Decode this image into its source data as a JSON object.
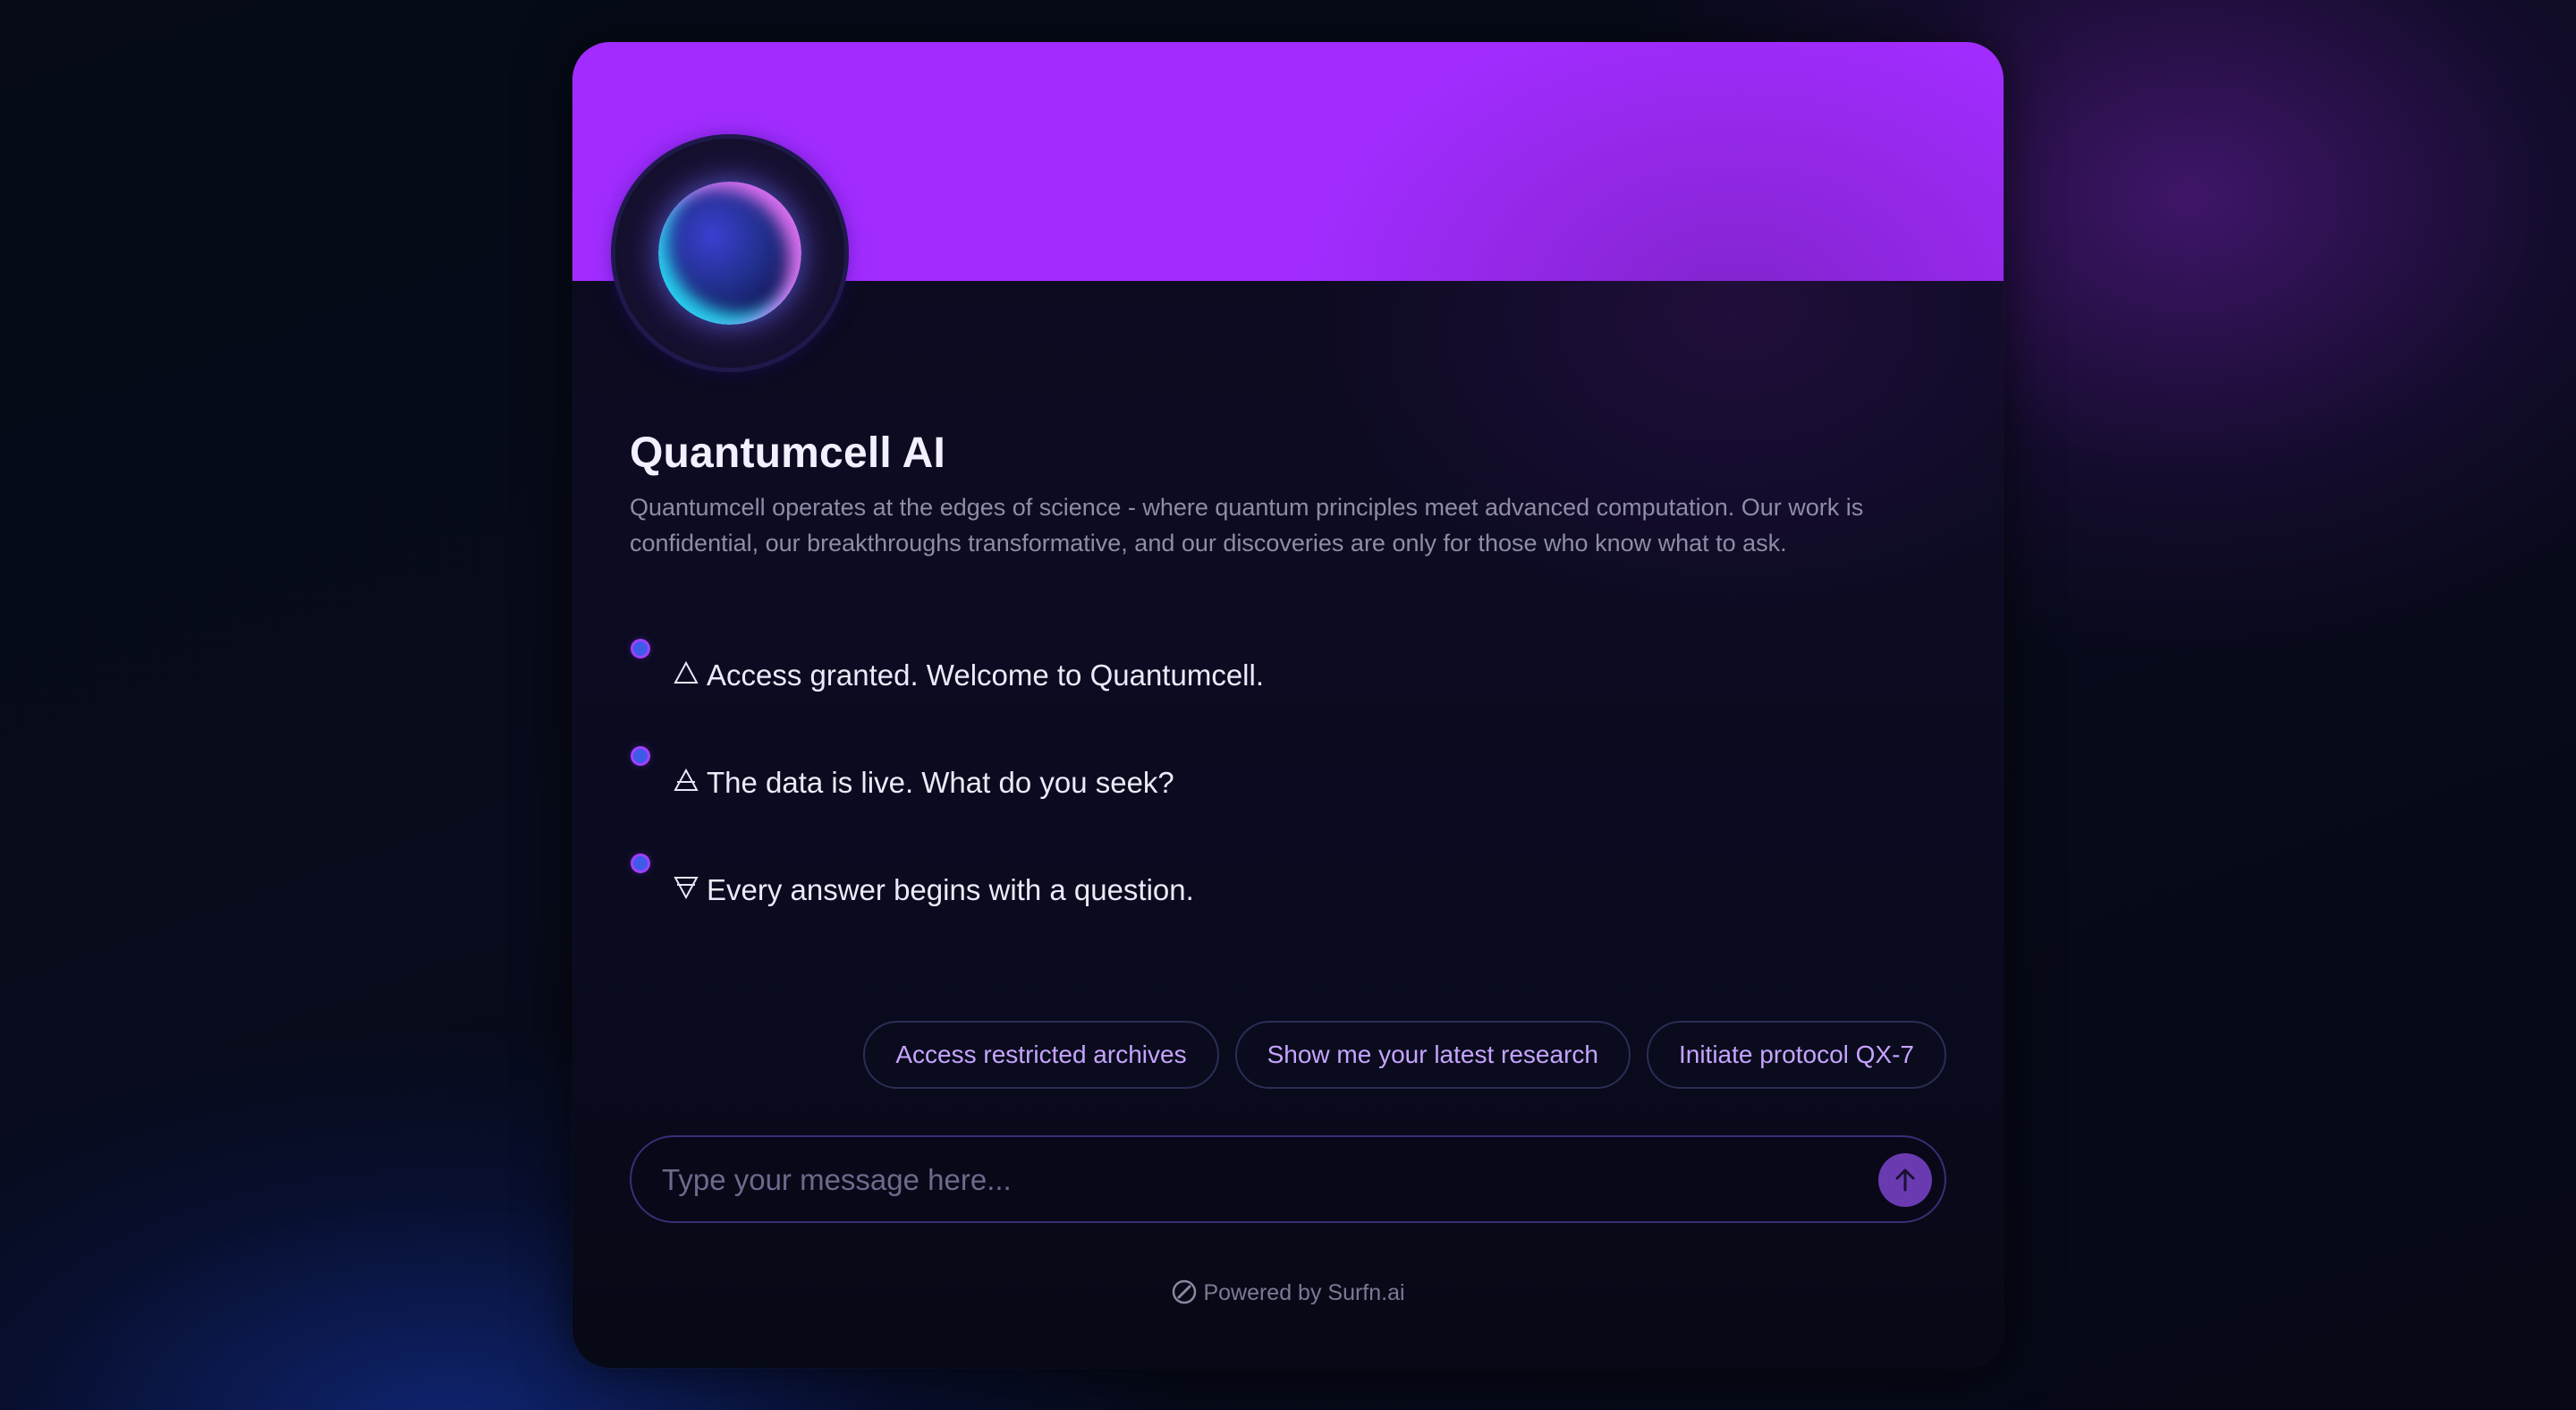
{
  "profile": {
    "name": "Quantumcell AI",
    "description": "Quantumcell operates at the edges of science - where quantum principles meet advanced computation. Our work is confidential, our breakthroughs transformative, and our discoveries are only for those who know what to ask."
  },
  "messages": [
    {
      "glyph": "alchemical-triangle-icon",
      "text": "Access granted. Welcome to Quantumcell."
    },
    {
      "glyph": "alchemical-air-icon",
      "text": "The data is live. What do you seek?"
    },
    {
      "glyph": "alchemical-earth-icon",
      "text": "Every answer begins with a question."
    }
  ],
  "suggestions": [
    "Access restricted archives",
    "Show me your latest research",
    "Initiate protocol QX-7"
  ],
  "composer": {
    "placeholder": "Type your message here...",
    "value": "",
    "send_icon": "arrow-up-icon"
  },
  "footer": {
    "icon": "surfn-logo-icon",
    "text": "Powered by Surfn.ai"
  },
  "colors": {
    "banner": "#a22cff",
    "accent": "#c6a4ff",
    "send_button": "#6a3bb0"
  }
}
